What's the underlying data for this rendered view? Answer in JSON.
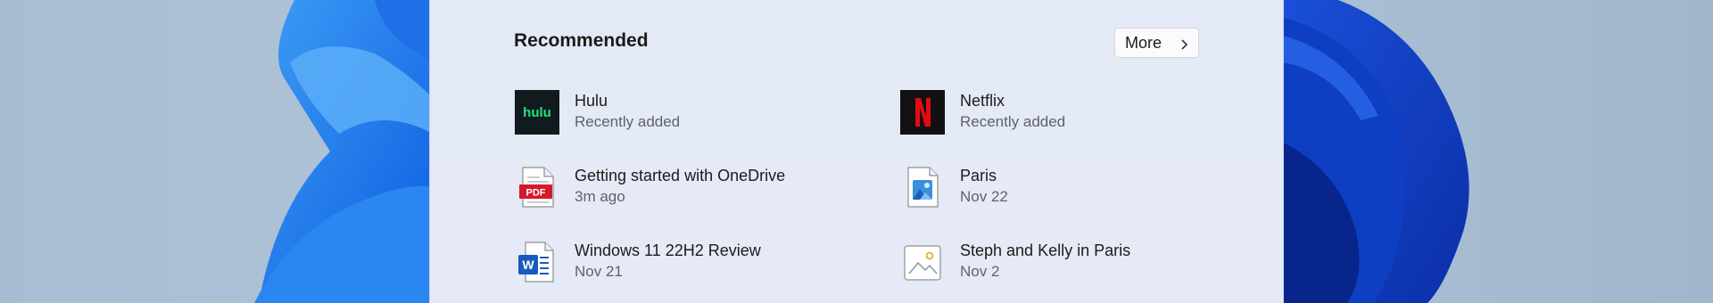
{
  "recommended": {
    "title": "Recommended",
    "more_label": "More",
    "items": [
      {
        "name": "Hulu",
        "sub": "Recently added",
        "icon": "hulu-icon",
        "logo_text": "hulu"
      },
      {
        "name": "Netflix",
        "sub": "Recently added",
        "icon": "netflix-icon"
      },
      {
        "name": "Getting started with OneDrive",
        "sub": "3m ago",
        "icon": "pdf-file-icon",
        "badge_text": "PDF"
      },
      {
        "name": "Paris",
        "sub": "Nov 22",
        "icon": "image-file-icon"
      },
      {
        "name": "Windows 11 22H2 Review",
        "sub": "Nov 21",
        "icon": "word-document-icon",
        "badge_text": "W"
      },
      {
        "name": "Steph and Kelly in Paris",
        "sub": "Nov 2",
        "icon": "photo-file-icon"
      }
    ]
  },
  "colors": {
    "hulu_green": "#1ce783",
    "netflix_red": "#e50914",
    "pdf_red": "#d5192b",
    "word_blue": "#185abd"
  }
}
